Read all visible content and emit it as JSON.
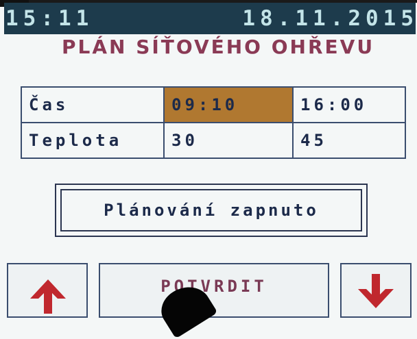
{
  "status_bar": {
    "time": "15:11",
    "date": "18.11.2015"
  },
  "title": "PLÁN SÍŤOVÉHO OHŘEVU",
  "schedule": {
    "rows": [
      {
        "label": "Čas",
        "value_1": "09:10",
        "value_2": "16:00"
      },
      {
        "label": "Teplota",
        "value_1": "30",
        "value_2": "45"
      }
    ],
    "selected_cell": "time.value_1"
  },
  "mode_status": "Plánování zapnuto",
  "buttons": {
    "confirm_label": "POTVRDIT",
    "up_icon": "arrow-up-icon",
    "down_icon": "arrow-down-icon"
  },
  "colors": {
    "status_bar_bg": "#1d3b4c",
    "title": "#8a3a55",
    "selected_cell": "#b07830",
    "arrow": "#c0282e"
  }
}
